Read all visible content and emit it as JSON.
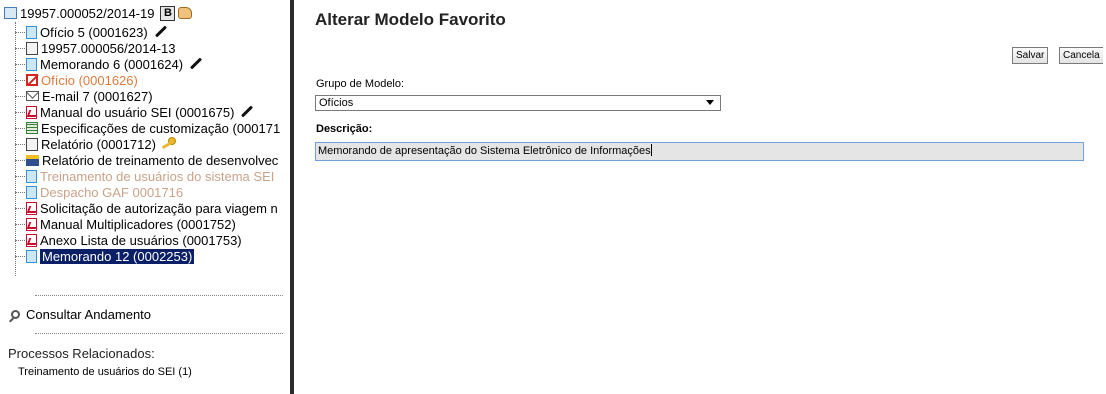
{
  "tree": {
    "process_number": "19957.000052/2014-19",
    "badge": "B",
    "items": [
      {
        "label": "Ofício 5 (0001623)"
      },
      {
        "label": "19957.000056/2014-13"
      },
      {
        "label": "Memorando 6 (0001624)"
      },
      {
        "label": "Ofício (0001626)"
      },
      {
        "label": "E-mail 7 (0001627)"
      },
      {
        "label": "Manual do usuário SEI (0001675)"
      },
      {
        "label": "Especificações de customização (000171"
      },
      {
        "label": "Relatório (0001712)"
      },
      {
        "label": "Relatório de treinamento de desenvolvec"
      },
      {
        "label": "Treinamento de usuários do sistema SEI"
      },
      {
        "label": "Despacho GAF 0001716"
      },
      {
        "label": "Solicitação de autorização para viagem n"
      },
      {
        "label": "Manual Multiplicadores (0001752)"
      },
      {
        "label": "Anexo Lista de usuários (0001753)"
      },
      {
        "label": "Memorando 12 (0002253)"
      }
    ]
  },
  "consult_label": "Consultar Andamento",
  "related": {
    "title": "Processos Relacionados:",
    "items": [
      {
        "label": "Treinamento de usuários do SEI (1)"
      }
    ]
  },
  "form": {
    "title": "Alterar Modelo Favorito",
    "save_label": "Salvar",
    "cancel_label": "Cancela",
    "group_label": "Grupo de Modelo:",
    "group_value": "Ofícios",
    "description_label": "Descrição:",
    "description_value": "Memorando de apresentação do Sistema Eletrônico de Informações"
  },
  "colors": {
    "selected_bg": "#0b1f66",
    "cancelled_text": "#e07a3b",
    "draft_text": "#c9a28a",
    "splitter": "#2b2b2b"
  }
}
